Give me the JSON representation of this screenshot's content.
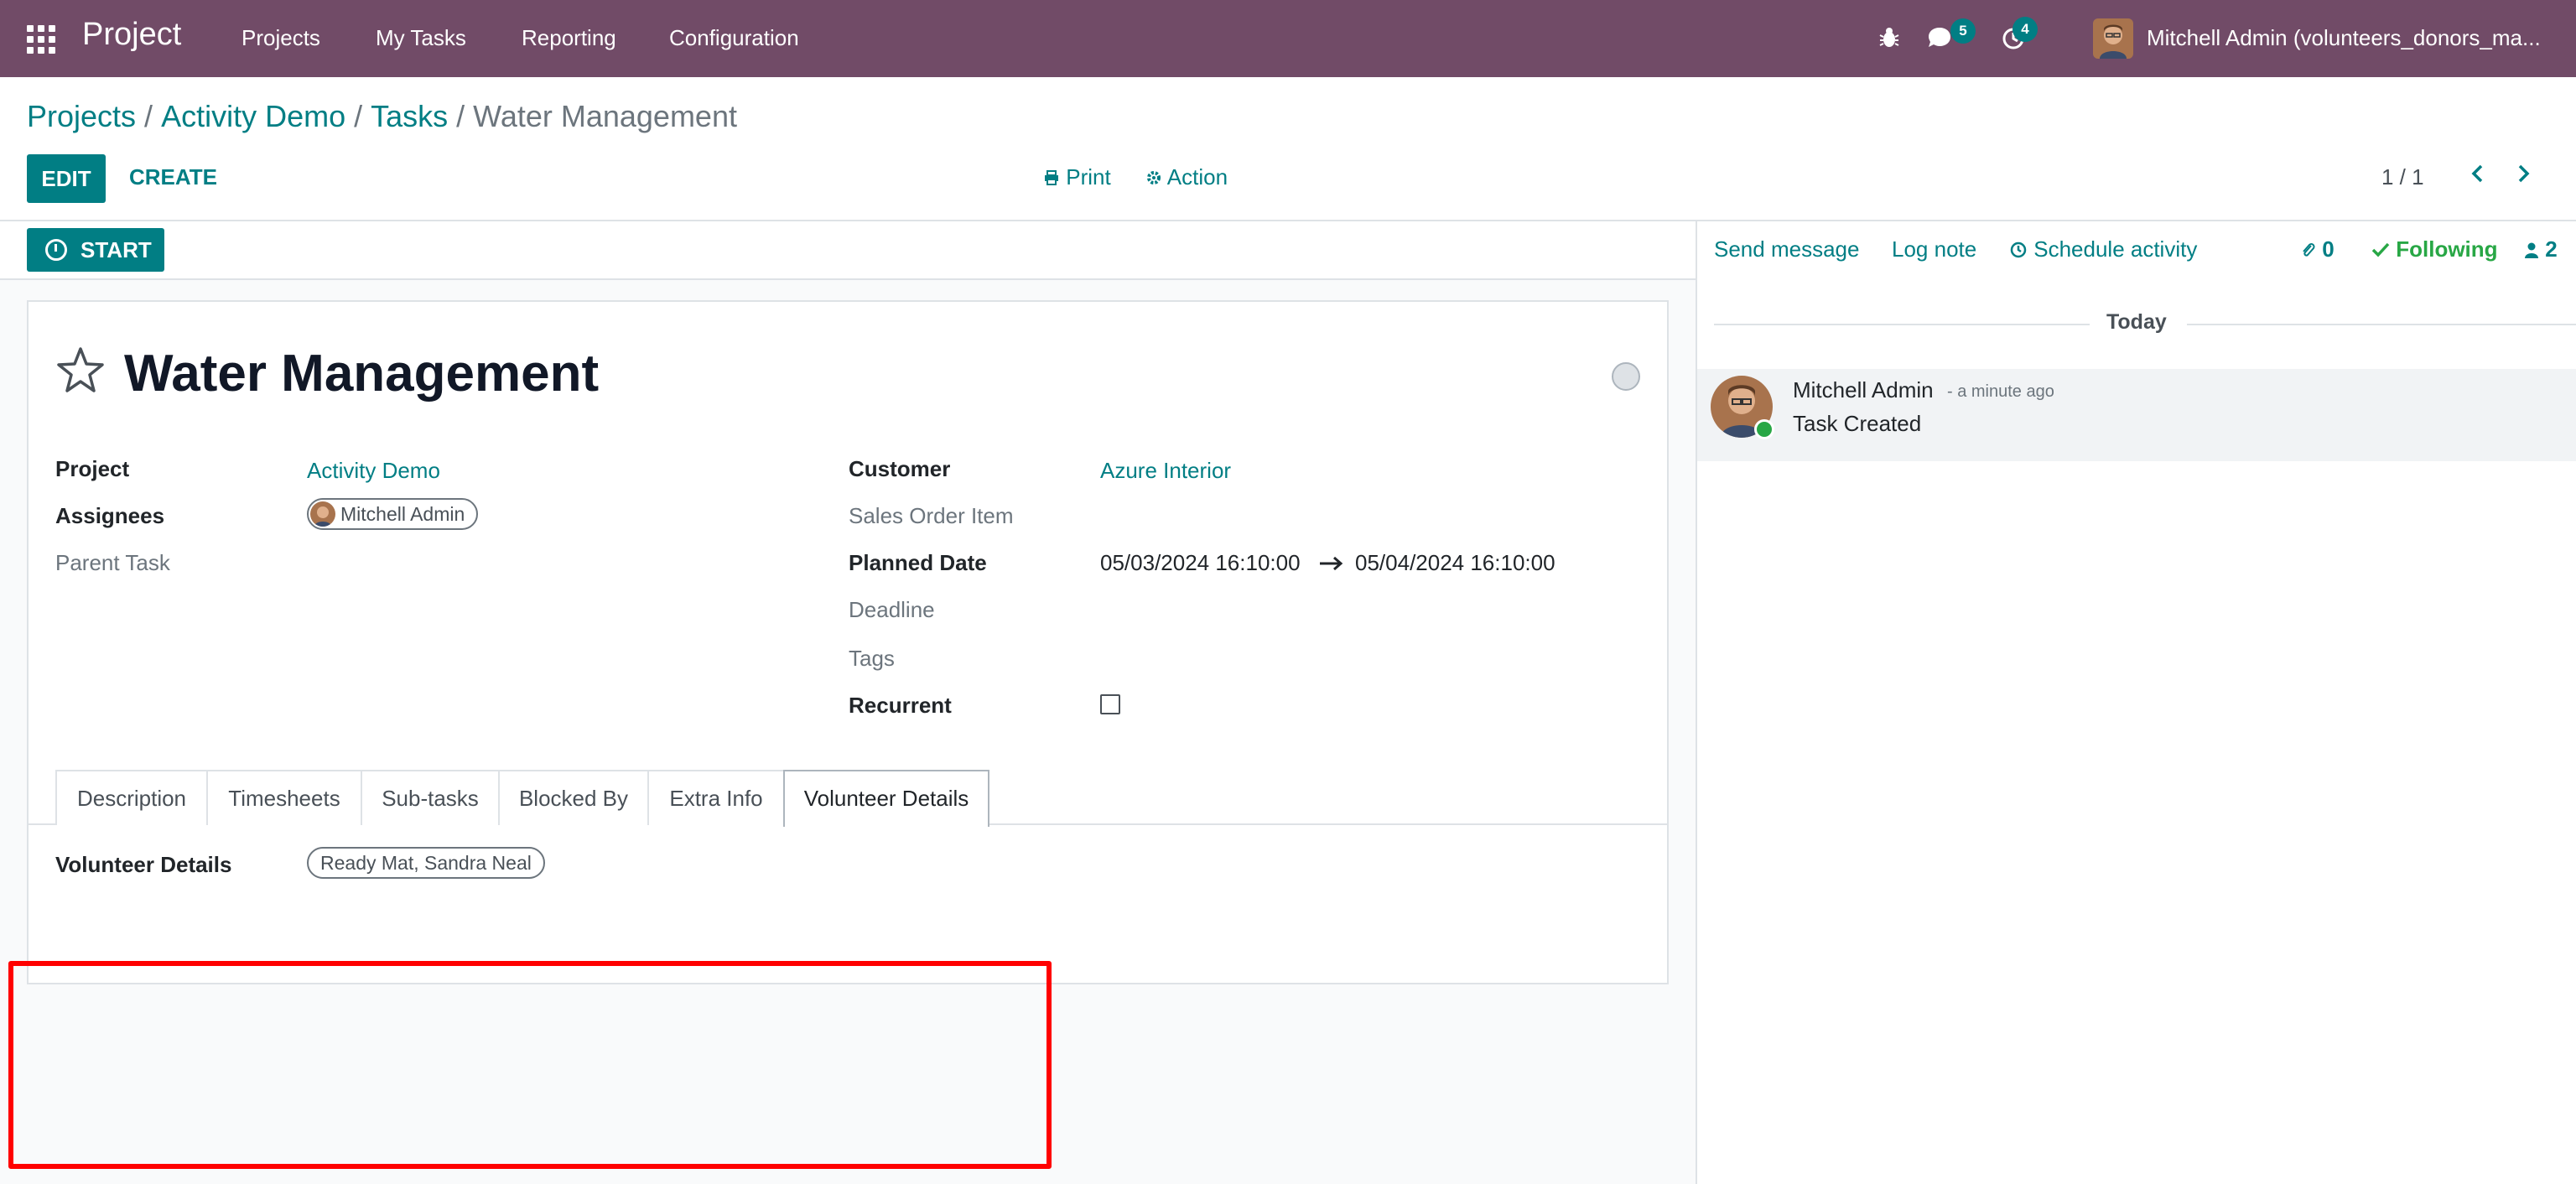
{
  "topbar": {
    "app_name": "Project",
    "menu": [
      "Projects",
      "My Tasks",
      "Reporting",
      "Configuration"
    ],
    "messages_count": "5",
    "activities_count": "4",
    "user": "Mitchell Admin (volunteers_donors_ma..."
  },
  "breadcrumb": {
    "items": [
      "Projects",
      "Activity Demo",
      "Tasks"
    ],
    "current": "Water Management"
  },
  "toolbar": {
    "edit_label": "EDIT",
    "create_label": "CREATE",
    "print_label": "Print",
    "action_label": "Action",
    "pager": "1 / 1"
  },
  "statusbar": {
    "start_label": "START"
  },
  "task": {
    "title": "Water Management",
    "fields": {
      "project_label": "Project",
      "project_value": "Activity Demo",
      "assignees_label": "Assignees",
      "assignee": "Mitchell Admin",
      "parent_task_label": "Parent Task",
      "customer_label": "Customer",
      "customer_value": "Azure Interior",
      "sales_order_item_label": "Sales Order Item",
      "planned_date_label": "Planned Date",
      "planned_start": "05/03/2024 16:10:00",
      "planned_end": "05/04/2024 16:10:00",
      "deadline_label": "Deadline",
      "tags_label": "Tags",
      "recurrent_label": "Recurrent"
    },
    "tabs": [
      "Description",
      "Timesheets",
      "Sub-tasks",
      "Blocked By",
      "Extra Info",
      "Volunteer Details"
    ],
    "active_tab": "Volunteer Details",
    "volunteer_details_label": "Volunteer Details",
    "volunteer_details_value": "Ready Mat, Sandra Neal"
  },
  "chatter": {
    "send_message": "Send message",
    "log_note": "Log note",
    "schedule_activity": "Schedule activity",
    "attachments_count": "0",
    "following": "Following",
    "followers_count": "2",
    "date_separator": "Today",
    "messages": [
      {
        "author": "Mitchell Admin",
        "time": "- a minute ago",
        "body": "Task Created"
      }
    ]
  },
  "colors": {
    "navbar": "#714b67",
    "accent": "#017e84",
    "highlight": "#ff0000"
  }
}
